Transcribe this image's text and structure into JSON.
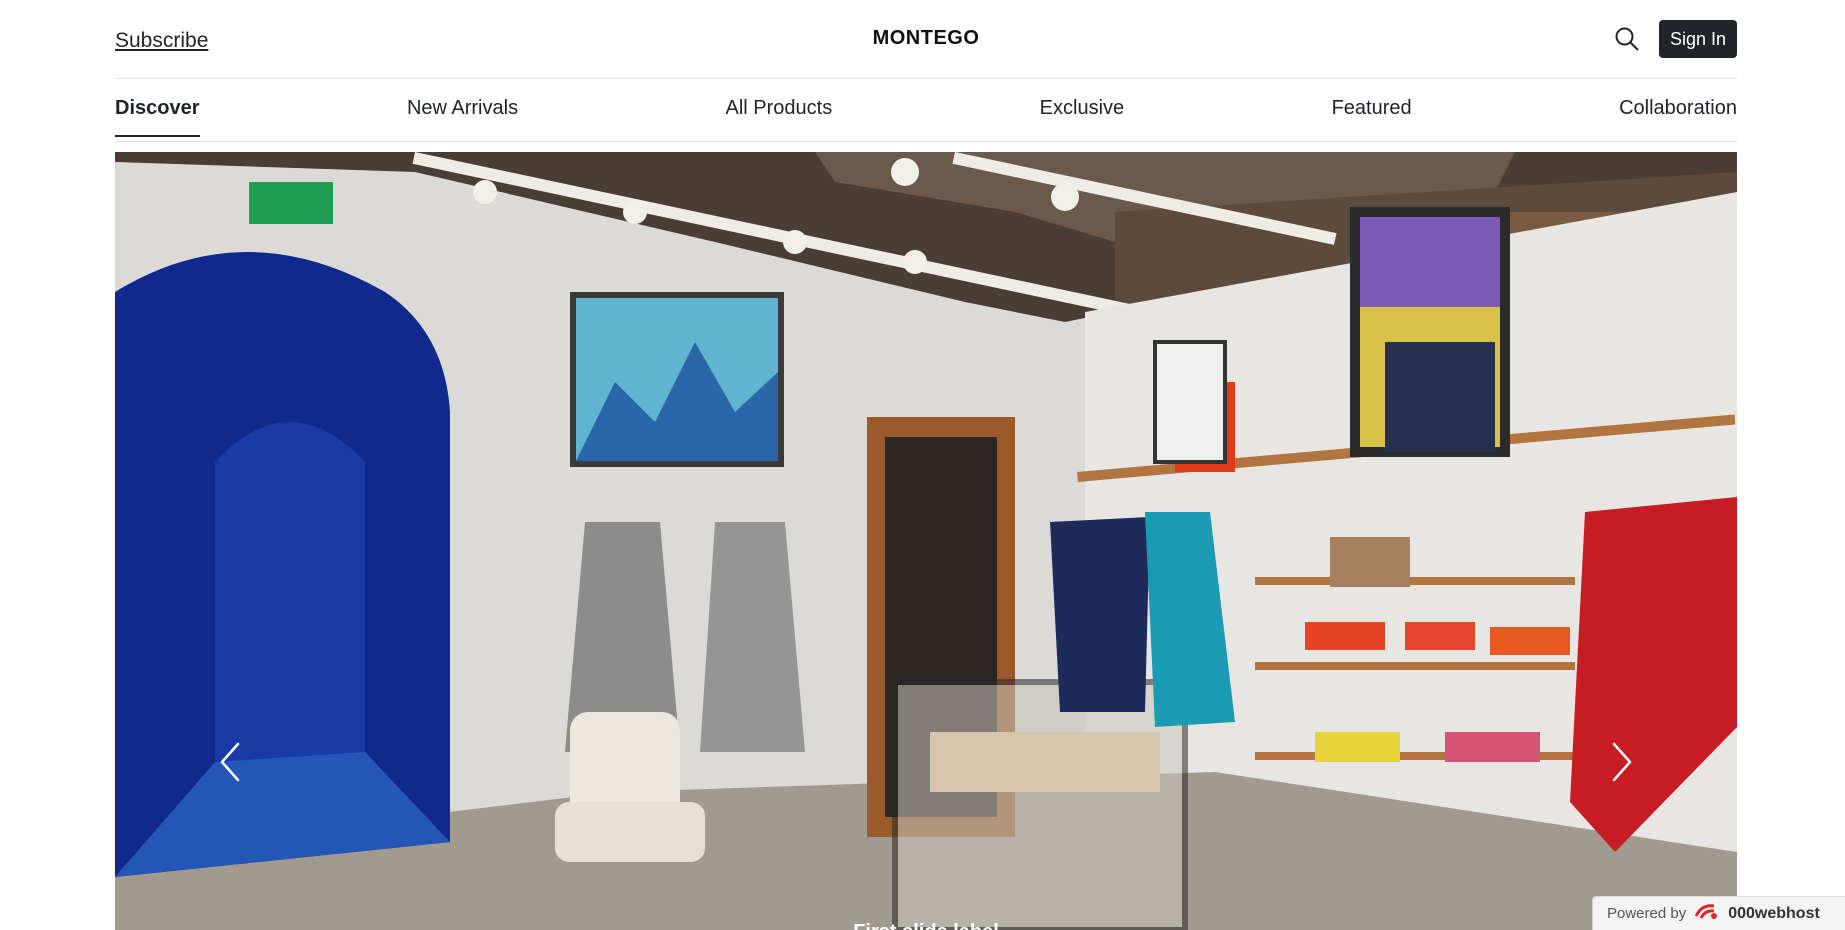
{
  "header": {
    "subscribe_label": "Subscribe",
    "brand": "MONTEGO",
    "search_icon": "search-icon",
    "signin_label": "Sign In"
  },
  "nav": {
    "items": [
      {
        "label": "Discover",
        "active": true
      },
      {
        "label": "New Arrivals",
        "active": false
      },
      {
        "label": "All Products",
        "active": false
      },
      {
        "label": "Exclusive",
        "active": false
      },
      {
        "label": "Featured",
        "active": false
      },
      {
        "label": "Collaboration",
        "active": false
      }
    ]
  },
  "carousel": {
    "prev_icon": "chevron-left-icon",
    "next_icon": "chevron-right-icon",
    "caption": "First slide label"
  },
  "badge": {
    "powered_label": "Powered by",
    "host_name": "000webhost"
  },
  "colors": {
    "button_dark": "#212529",
    "divider": "#dee2e6",
    "arch_blue": "#0f2a8c"
  }
}
